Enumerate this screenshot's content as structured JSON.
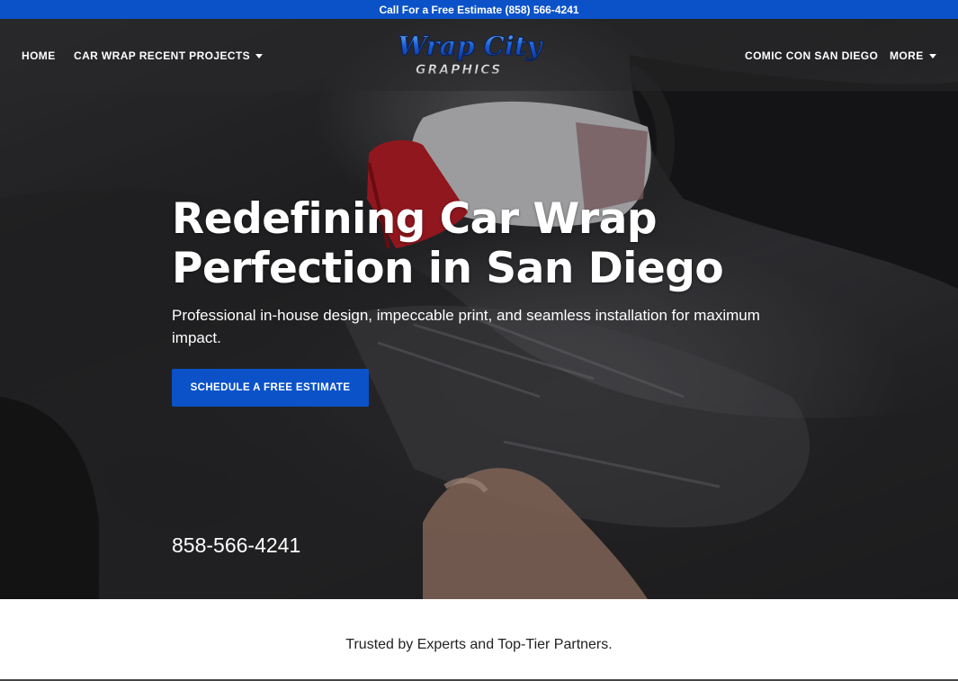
{
  "topbar": {
    "text": "Call For a Free Estimate (858) 566-4241"
  },
  "nav": {
    "left": [
      {
        "label": "HOME"
      },
      {
        "label": "CAR WRAP RECENT PROJECTS"
      }
    ],
    "right": [
      {
        "label": "COMIC CON SAN DIEGO"
      },
      {
        "label": "MORE"
      }
    ]
  },
  "logo": {
    "line1": "Wrap City",
    "line2": "GRAPHICS"
  },
  "hero": {
    "headline_line1": "Redefining Car Wrap",
    "headline_line2": "Perfection in San Diego",
    "subtext": "Professional in-house design, impeccable print, and seamless installation for maximum impact.",
    "cta_label": "SCHEDULE A FREE ESTIMATE",
    "phone": "858-566-4241"
  },
  "trusted": {
    "text": "Trusted by Experts and Top-Tier Partners."
  },
  "colors": {
    "brand_blue": "#0b52c9",
    "squeegee_red": "#c8202a"
  },
  "icons": {
    "dropdown": "caret-down-icon"
  }
}
